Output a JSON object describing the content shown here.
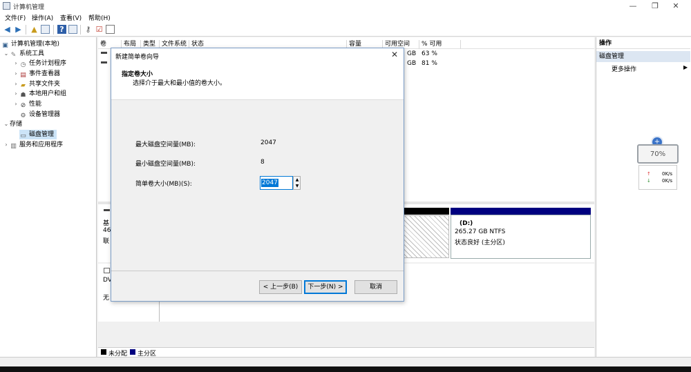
{
  "window": {
    "title": "计算机管理"
  },
  "menu": [
    {
      "label": "文件(F)"
    },
    {
      "label": "操作(A)"
    },
    {
      "label": "查看(V)"
    },
    {
      "label": "帮助(H)"
    }
  ],
  "tree": {
    "root": "计算机管理(本地)",
    "system_tools": "系统工具",
    "task_scheduler": "任务计划程序",
    "event_viewer": "事件查看器",
    "shared_folders": "共享文件夹",
    "local_users": "本地用户和组",
    "performance": "性能",
    "device_manager": "设备管理器",
    "storage": "存储",
    "disk_management": "磁盘管理",
    "services_apps": "服务和应用程序"
  },
  "volume_table": {
    "columns": [
      "卷",
      "布局",
      "类型",
      "文件系统",
      "状态",
      "容量",
      "可用空间",
      "% 可用"
    ],
    "rows": [
      {
        "free_unit": "GB",
        "pct": "63 %"
      },
      {
        "free_unit": "GB",
        "pct": "81 %"
      }
    ]
  },
  "disk_area": {
    "disk0_label_a": "基",
    "disk0_label_b": "46",
    "disk0_label_c": "联",
    "dvd_label": "DV",
    "dvd_label_b": "无",
    "partition_d_name": "(D:)",
    "partition_d_size": "265.27 GB NTFS",
    "partition_d_status": "状态良好 (主分区)"
  },
  "legend": {
    "unallocated": "未分配",
    "primary": "主分区",
    "unallocated_color": "#000000",
    "primary_color": "#00007f"
  },
  "actions": {
    "header": "操作",
    "section": "磁盘管理",
    "more": "更多操作"
  },
  "widget": {
    "percent": "70%",
    "up_speed": "0K/s",
    "down_speed": "0K/s"
  },
  "dialog": {
    "title": "新建简单卷向导",
    "heading": "指定卷大小",
    "subheading": "选择介于最大和最小值的卷大小。",
    "max_label": "最大磁盘空间量(MB):",
    "max_value": "2047",
    "min_label": "最小磁盘空间量(MB):",
    "min_value": "8",
    "size_label": "简单卷大小(MB)(S):",
    "size_value": "2047",
    "back": "< 上一步(B)",
    "next": "下一步(N) >",
    "cancel": "取消"
  },
  "colors": {
    "accent": "#0078d7",
    "selection": "#cce4f7",
    "action_header": "#dce6f2"
  }
}
